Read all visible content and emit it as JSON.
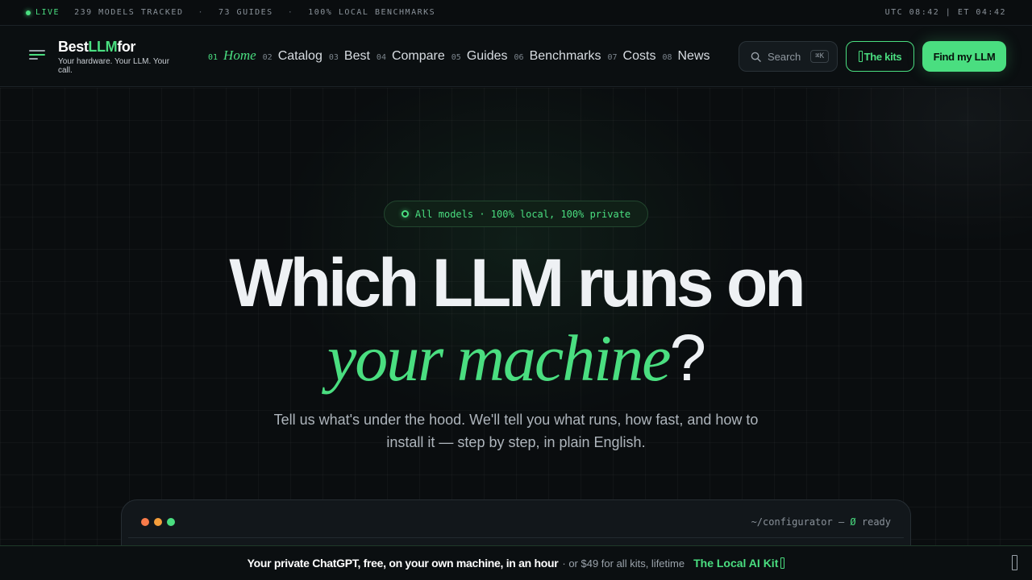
{
  "ticker": {
    "live": "LIVE",
    "items": [
      "239 MODELS TRACKED",
      "73 GUIDES",
      "100% LOCAL BENCHMARKS"
    ],
    "separator": "·",
    "clock": "UTC 08:42 | ET 04:42"
  },
  "brand": {
    "name_a": "Best",
    "name_b": "LLM",
    "name_c": "for",
    "tagline": "Your hardware. Your LLM. Your call."
  },
  "nav": [
    {
      "num": "01",
      "label": "Home",
      "active": true
    },
    {
      "num": "02",
      "label": "Catalog"
    },
    {
      "num": "03",
      "label": "Best"
    },
    {
      "num": "04",
      "label": "Compare"
    },
    {
      "num": "05",
      "label": "Guides"
    },
    {
      "num": "06",
      "label": "Benchmarks"
    },
    {
      "num": "07",
      "label": "Costs"
    },
    {
      "num": "08",
      "label": "News"
    }
  ],
  "search": {
    "label": "Search",
    "shortcut": "⌘K"
  },
  "buttons": {
    "kits": "The kits",
    "find": "Find my LLM"
  },
  "hero": {
    "pill": "All models · 100% local, 100% private",
    "headline": "Which LLM runs on",
    "headline_accent": "your machine",
    "headline_end": "?",
    "subtitle": "Tell us what's under the hood. We'll tell you what runs, how fast, and how to install it — step by step, in plain English."
  },
  "terminal": {
    "path": "~/configurator —",
    "status_icon": "Ø",
    "status": "ready",
    "dot_colors": [
      "#f97b4a",
      "#f59e3b",
      "#4ade80"
    ]
  },
  "banner": {
    "main": "Your private ChatGPT, free, on your own machine, in an hour",
    "sub": "· or $49 for all kits, lifetime",
    "cta": "The Local AI Kit"
  },
  "colors": {
    "accent": "#4ade80",
    "background": "#0a0d0f"
  }
}
